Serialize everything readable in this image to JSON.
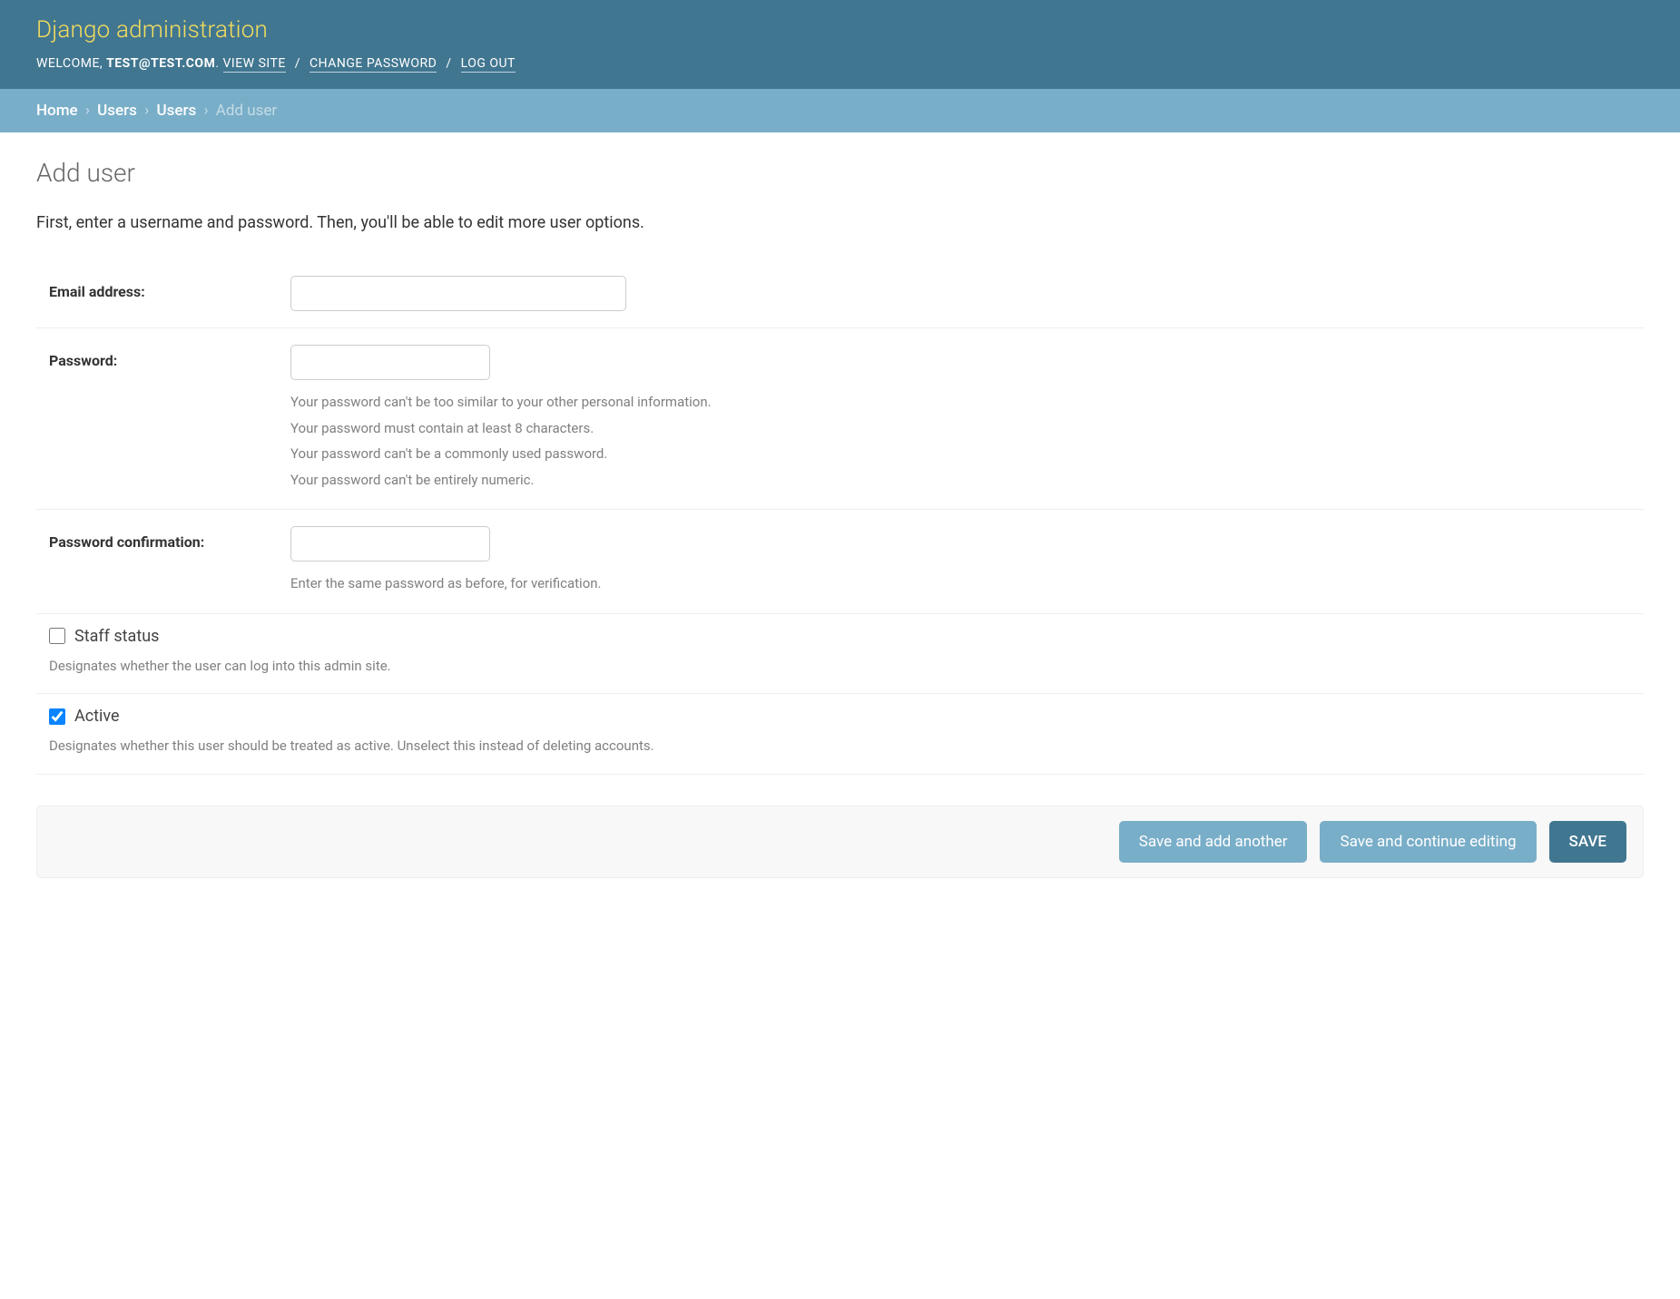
{
  "header": {
    "branding": "Django administration",
    "welcome_prefix": "WELCOME, ",
    "user": "TEST@TEST.COM",
    "period": ". ",
    "view_site": "VIEW SITE",
    "change_password": "CHANGE PASSWORD",
    "log_out": "LOG OUT",
    "sep": " / "
  },
  "breadcrumbs": {
    "home": "Home",
    "app": "Users",
    "model": "Users",
    "current": "Add user",
    "sep": "›"
  },
  "page": {
    "title": "Add user",
    "intro": "First, enter a username and password. Then, you'll be able to edit more user options."
  },
  "fields": {
    "email": {
      "label": "Email address:"
    },
    "password": {
      "label": "Password:",
      "help": [
        "Your password can't be too similar to your other personal information.",
        "Your password must contain at least 8 characters.",
        "Your password can't be a commonly used password.",
        "Your password can't be entirely numeric."
      ]
    },
    "password2": {
      "label": "Password confirmation:",
      "help": "Enter the same password as before, for verification."
    },
    "staff": {
      "label": "Staff status",
      "help": "Designates whether the user can log into this admin site.",
      "checked": false
    },
    "active": {
      "label": "Active",
      "help": "Designates whether this user should be treated as active. Unselect this instead of deleting accounts.",
      "checked": true
    }
  },
  "buttons": {
    "save_add_another": "Save and add another",
    "save_continue": "Save and continue editing",
    "save": "SAVE"
  }
}
